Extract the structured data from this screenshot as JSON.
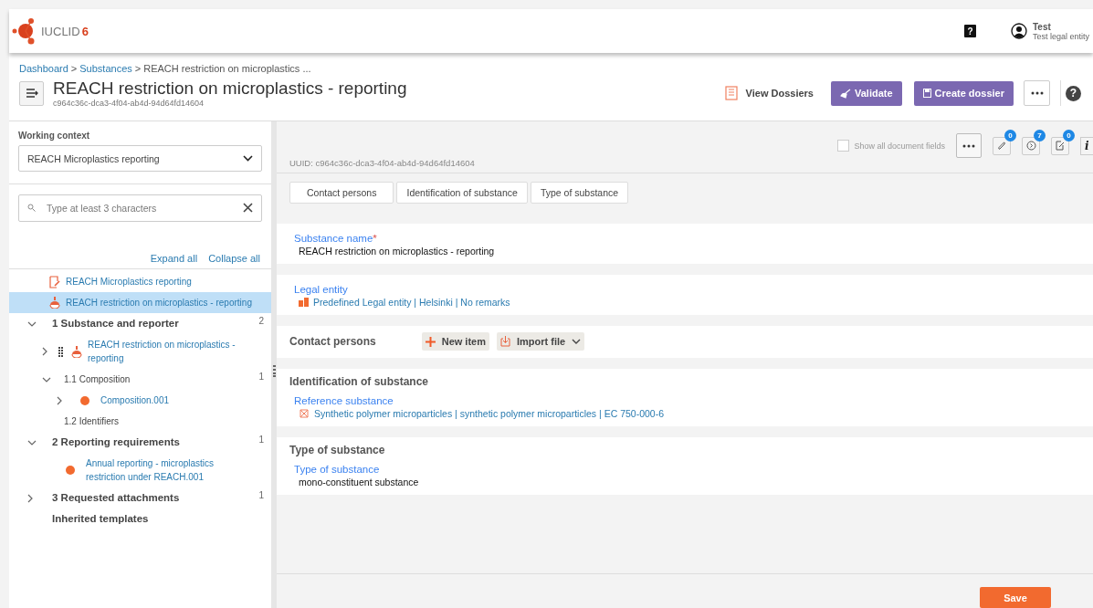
{
  "header": {
    "logo_text": "IUCLID",
    "logo_version": "6",
    "help_label": "?",
    "user_name": "Test",
    "user_entity": "Test legal entity"
  },
  "breadcrumb": {
    "separator": ">",
    "items": [
      {
        "kind": "link",
        "label": "Dashboard"
      },
      {
        "kind": "link",
        "label": "Substances"
      },
      {
        "kind": "current",
        "label": "REACH restriction on microplastics ..."
      }
    ]
  },
  "page": {
    "title": "REACH restriction on microplastics - reporting",
    "uuid": "c964c36c-dca3-4f04-ab4d-94d64fd14604"
  },
  "actions": [
    {
      "kind": "plain",
      "label": "View Dossiers"
    },
    {
      "kind": "validate",
      "label": "Validate"
    },
    {
      "kind": "dossier",
      "label": "Create dossier"
    },
    {
      "kind": "more"
    },
    {
      "kind": "help",
      "label": "?"
    }
  ],
  "sidebar": {
    "context_label": "Working context",
    "context_value": "REACH Microplastics reporting",
    "search_placeholder": "Type at least 3 characters",
    "expand_all": "Expand all",
    "collapse_all": "Collapse all",
    "tree": [
      {
        "kind": "document",
        "label": "REACH Microplastics reporting",
        "selected": false
      },
      {
        "kind": "substance",
        "label": "REACH restriction on microplastics - reporting",
        "selected": true
      },
      {
        "kind": "section",
        "label": "1 Substance and reporter",
        "count": "2",
        "expanded": true,
        "selected": false,
        "children": [
          {
            "kind": "substance",
            "label": "REACH restriction on microplastics - reporting",
            "expanded": false,
            "draggable": true,
            "selected": false
          },
          {
            "kind": "subsection",
            "label": "1.1 Composition",
            "count": "1",
            "expanded": true,
            "selected": false,
            "children": [
              {
                "kind": "record",
                "label": "Composition.001",
                "expanded": false,
                "selected": false
              }
            ]
          },
          {
            "kind": "subsection",
            "label": "1.2 Identifiers",
            "selected": false
          }
        ]
      },
      {
        "kind": "section",
        "label": "2 Reporting requirements",
        "count": "1",
        "expanded": true,
        "selected": false,
        "children": [
          {
            "kind": "record",
            "label": "Annual reporting - microplastics restriction under REACH.001",
            "selected": false
          }
        ]
      },
      {
        "kind": "section",
        "label": "3 Requested attachments",
        "count": "1",
        "expanded": false,
        "selected": false
      },
      {
        "kind": "section",
        "label": "Inherited templates",
        "selected": false
      }
    ]
  },
  "toolbar": {
    "uuid": "UUID: c964c36c-dca3-4f04-ab4d-94d64fd14604",
    "show_all_label": "Show all document fields",
    "show_all_checked": false,
    "badges": [
      {
        "kind": "attachment",
        "count": "0"
      },
      {
        "kind": "clock",
        "count": "7"
      },
      {
        "kind": "note",
        "count": "0"
      }
    ],
    "info_label": "i"
  },
  "tabs": [
    {
      "label": "Contact persons",
      "selected": false
    },
    {
      "label": "Identification of substance",
      "selected": false
    },
    {
      "label": "Type of substance",
      "selected": false
    }
  ],
  "sections": [
    {
      "fields": [
        {
          "kind": "text",
          "label": "Substance name",
          "required_mark": "*",
          "value": "REACH restriction on microplastics - reporting"
        }
      ]
    },
    {
      "fields": [
        {
          "kind": "entity",
          "label": "Legal entity",
          "value": "Predefined Legal entity | Helsinki | No remarks"
        }
      ]
    },
    {
      "title": "Contact persons",
      "actions": [
        {
          "kind": "new",
          "label": "New item"
        },
        {
          "kind": "import",
          "label": "Import file"
        }
      ]
    },
    {
      "title": "Identification of substance",
      "fields": [
        {
          "kind": "substance",
          "label": "Reference substance",
          "value": "Synthetic polymer microparticles | synthetic polymer microparticles | EC 750-000-6"
        }
      ]
    },
    {
      "title": "Type of substance",
      "fields": [
        {
          "kind": "text",
          "label": "Type of substance",
          "value": "mono-constituent substance"
        }
      ]
    }
  ],
  "footer": {
    "save_label": "Save"
  }
}
